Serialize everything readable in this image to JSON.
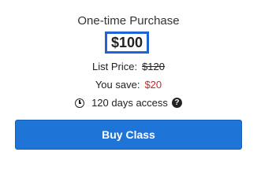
{
  "purchase": {
    "type_label": "One-time Purchase",
    "price": "$100",
    "list_price_label": "List Price:",
    "list_price_value": "$120",
    "save_label": "You save:",
    "save_value": "$20",
    "access_text": "120 days access",
    "help_glyph": "?",
    "buy_label": "Buy Class"
  },
  "icons": {
    "clock": "clock-icon",
    "help": "question-circle-icon"
  },
  "colors": {
    "accent": "#1f74d8",
    "price_border": "#1f63d6",
    "savings": "#d61f1f"
  }
}
